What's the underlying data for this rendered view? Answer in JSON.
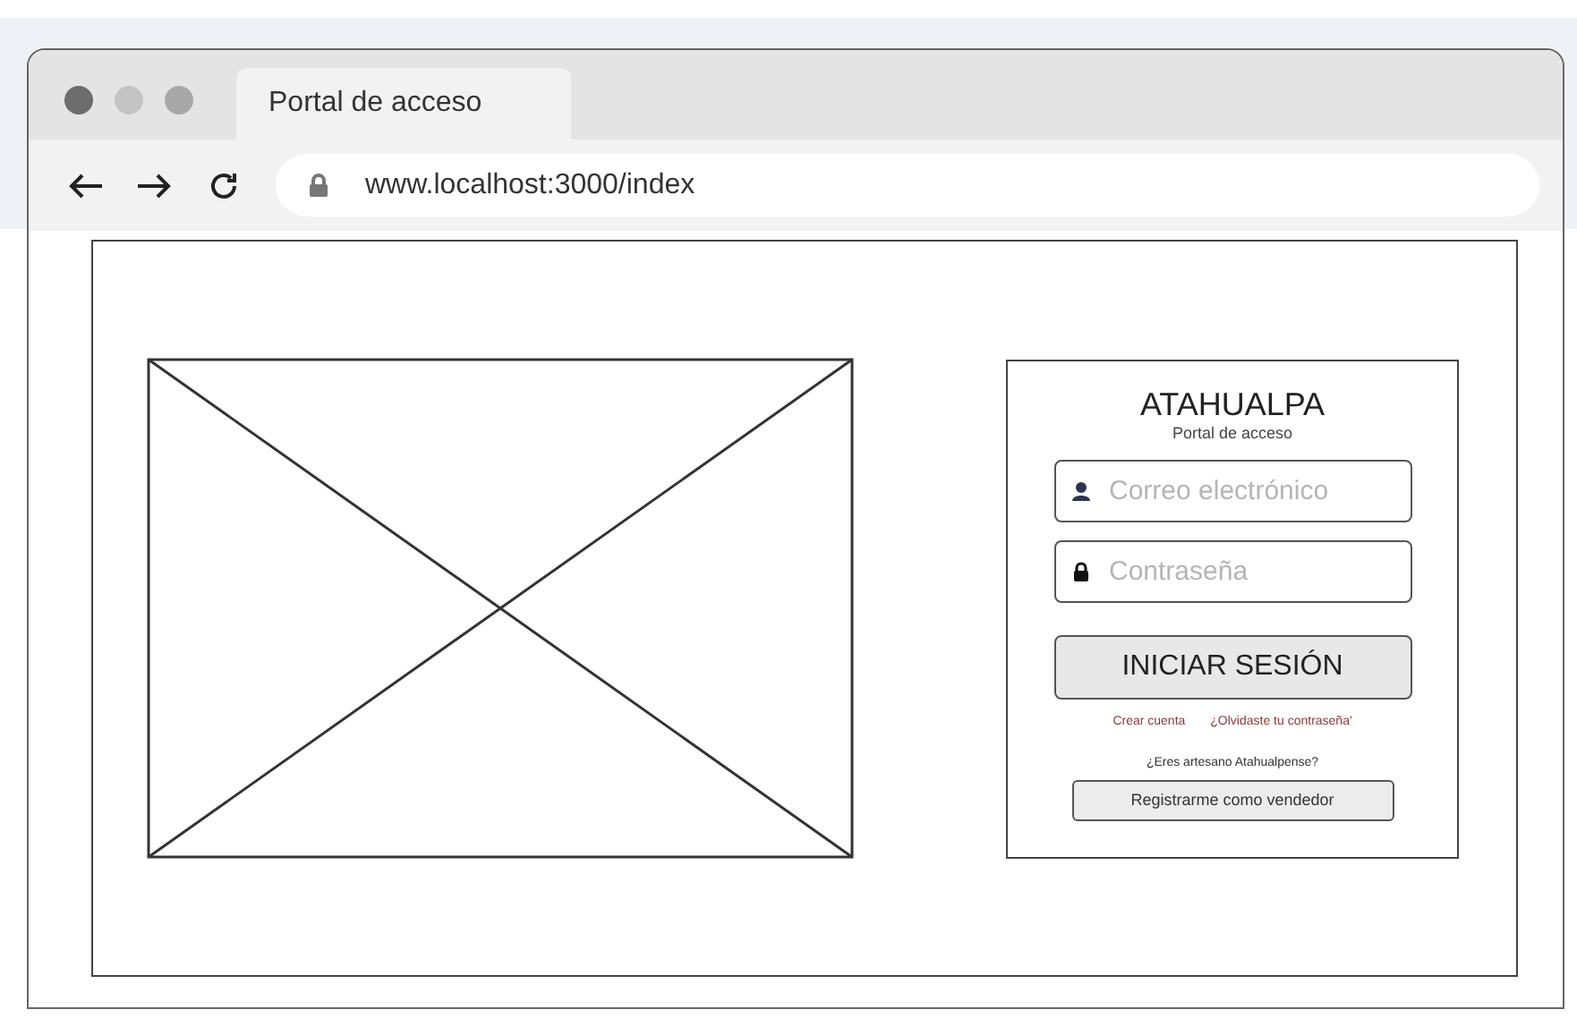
{
  "window": {
    "title": "Portal de acceso",
    "url": "www.localhost:3000/index"
  },
  "login": {
    "brand": "ATAHUALPA",
    "subtitle": "Portal de acceso",
    "fields": [
      {
        "kind": "user",
        "placeholder": "Correo electrónico"
      },
      {
        "kind": "lock",
        "placeholder": "Contraseña"
      }
    ],
    "submit": "INICIAR SESIÓN",
    "links": [
      "Crear cuenta",
      "¿Olvidaste tu contraseña'"
    ],
    "question": "¿Eres artesano Atahualpense?",
    "register": "Registrarme como vendedor"
  }
}
